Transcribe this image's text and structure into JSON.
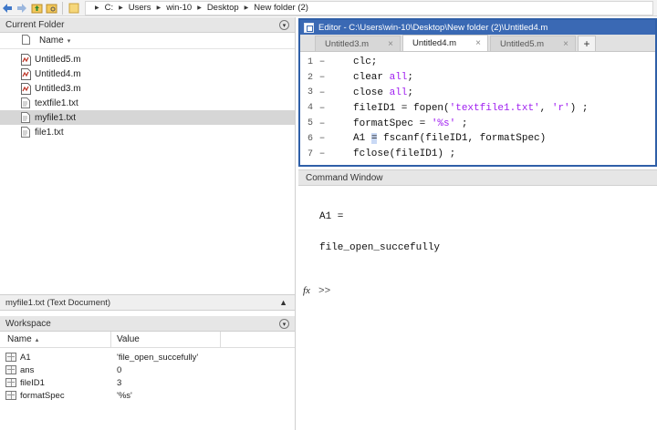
{
  "address": {
    "crumbs": [
      "C:",
      "Users",
      "win-10",
      "Desktop",
      "New folder (2)"
    ]
  },
  "current_folder": {
    "title": "Current Folder",
    "column_name": "Name",
    "files": [
      {
        "name": "Untitled5.m",
        "type": "m",
        "selected": false
      },
      {
        "name": "Untitled4.m",
        "type": "m",
        "selected": false
      },
      {
        "name": "Untitled3.m",
        "type": "m",
        "selected": false
      },
      {
        "name": "textfile1.txt",
        "type": "txt",
        "selected": false
      },
      {
        "name": "myfile1.txt",
        "type": "txt",
        "selected": true
      },
      {
        "name": "file1.txt",
        "type": "txt",
        "selected": false
      }
    ],
    "detail": "myfile1.txt (Text Document)"
  },
  "workspace": {
    "title": "Workspace",
    "col_name": "Name",
    "col_value": "Value",
    "rows": [
      {
        "name": "A1",
        "value": "'file_open_succefully'"
      },
      {
        "name": "ans",
        "value": "0"
      },
      {
        "name": "fileID1",
        "value": "3"
      },
      {
        "name": "formatSpec",
        "value": "'%s'"
      }
    ]
  },
  "editor": {
    "title": "Editor - C:\\Users\\win-10\\Desktop\\New folder (2)\\Untitled4.m",
    "tabs": [
      {
        "label": "Untitled3.m",
        "active": false
      },
      {
        "label": "Untitled4.m",
        "active": true
      },
      {
        "label": "Untitled5.m",
        "active": false
      }
    ],
    "lines": [
      {
        "n": "1",
        "parts": [
          {
            "t": "clc;"
          }
        ]
      },
      {
        "n": "2",
        "parts": [
          {
            "t": "clear "
          },
          {
            "t": "all",
            "s": true
          },
          {
            "t": ";"
          }
        ]
      },
      {
        "n": "3",
        "parts": [
          {
            "t": "close "
          },
          {
            "t": "all",
            "s": true
          },
          {
            "t": ";"
          }
        ]
      },
      {
        "n": "4",
        "parts": [
          {
            "t": "fileID1 = fopen("
          },
          {
            "t": "'textfile1.txt'",
            "s": true
          },
          {
            "t": ", "
          },
          {
            "t": "'r'",
            "s": true
          },
          {
            "t": ") ;"
          }
        ]
      },
      {
        "n": "5",
        "parts": [
          {
            "t": "formatSpec = "
          },
          {
            "t": "'%s'",
            "s": true
          },
          {
            "t": " ;"
          }
        ]
      },
      {
        "n": "6",
        "parts": [
          {
            "t": "A1 "
          },
          {
            "t": "=",
            "h": true
          },
          {
            "t": " fscanf(fileID1, formatSpec)"
          }
        ]
      },
      {
        "n": "7",
        "parts": [
          {
            "t": "fclose(fileID1) ;"
          }
        ]
      }
    ]
  },
  "command_window": {
    "title": "Command Window",
    "output": [
      "A1 =",
      "file_open_succefully"
    ],
    "fx": "fx",
    "prompt": ">>"
  }
}
